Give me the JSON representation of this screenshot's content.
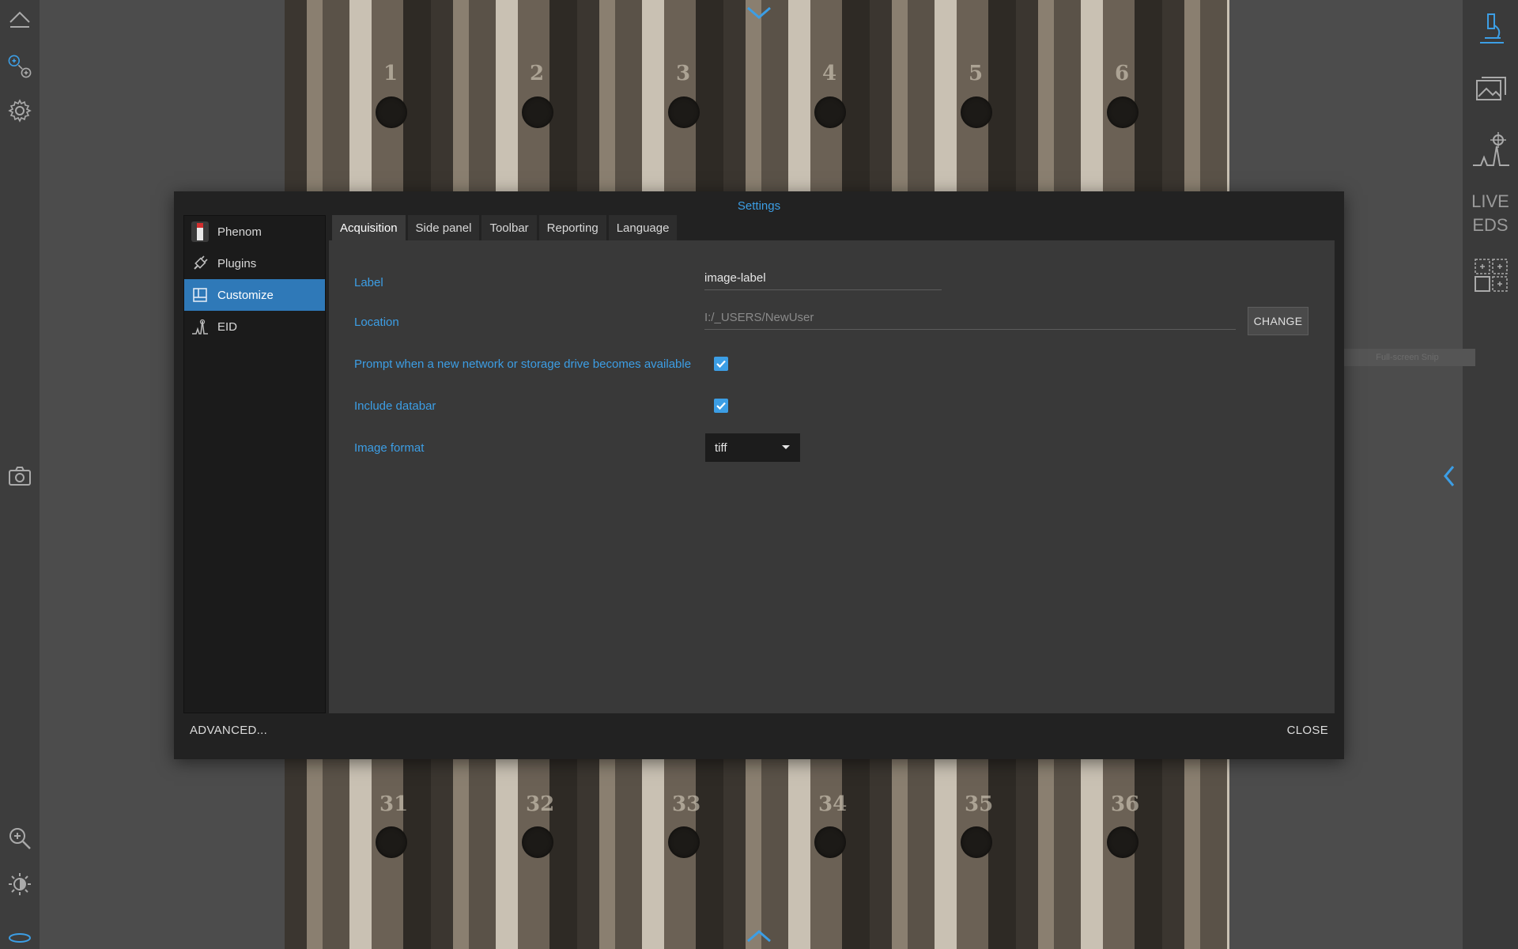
{
  "dialog": {
    "title": "Settings",
    "advanced_label": "ADVANCED...",
    "close_label": "CLOSE"
  },
  "nav": {
    "items": [
      {
        "label": "Phenom",
        "icon": "phenom-device-icon",
        "active": false
      },
      {
        "label": "Plugins",
        "icon": "plug-icon",
        "active": false
      },
      {
        "label": "Customize",
        "icon": "layout-icon",
        "active": true
      },
      {
        "label": "EID",
        "icon": "spectrum-icon",
        "active": false
      }
    ]
  },
  "tabs": [
    {
      "label": "Acquisition",
      "active": true
    },
    {
      "label": "Side panel",
      "active": false
    },
    {
      "label": "Toolbar",
      "active": false
    },
    {
      "label": "Reporting",
      "active": false
    },
    {
      "label": "Language",
      "active": false
    }
  ],
  "acquisition": {
    "label_field": {
      "label": "Label",
      "value": "image-label"
    },
    "location_field": {
      "label": "Location",
      "value": "I:/_USERS/NewUser",
      "button": "CHANGE"
    },
    "prompt_drive": {
      "label": "Prompt when a new network or storage drive becomes available",
      "checked": true
    },
    "include_databar": {
      "label": "Include databar",
      "checked": true
    },
    "image_format": {
      "label": "Image format",
      "value": "tiff"
    }
  },
  "right_rail": {
    "live_eds_line1": "LIVE",
    "live_eds_line2": "EDS",
    "tooltip": "Full-screen Snip"
  },
  "sample_numbers_top": [
    "1",
    "2",
    "3",
    "4",
    "5",
    "6"
  ],
  "sample_numbers_bottom": [
    "31",
    "32",
    "33",
    "34",
    "35",
    "36"
  ],
  "colors": {
    "accent": "#3c9ee5",
    "active_nav": "#2f79b8",
    "dialog_bg": "#222222",
    "panel_bg": "#393939"
  }
}
